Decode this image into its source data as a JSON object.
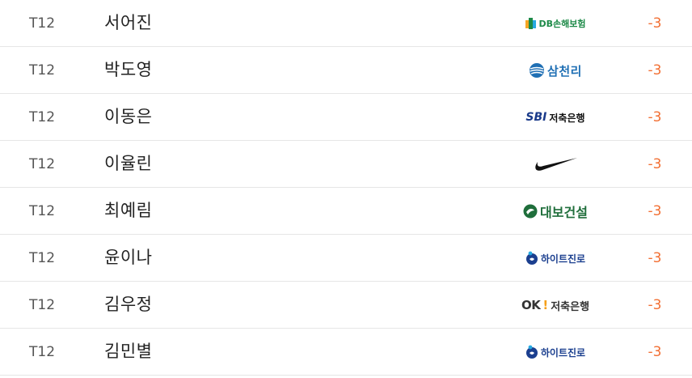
{
  "rows": [
    {
      "rank": "T12",
      "name": "서어진",
      "sponsor": {
        "logo": "db-insurance-logo",
        "text": "DB손해보험"
      },
      "score": "-3"
    },
    {
      "rank": "T12",
      "name": "박도영",
      "sponsor": {
        "logo": "samchully-logo",
        "text": "삼천리"
      },
      "score": "-3"
    },
    {
      "rank": "T12",
      "name": "이동은",
      "sponsor": {
        "logo": "sbi-savings-bank-logo",
        "mark": "SBI",
        "text": "저축은행"
      },
      "score": "-3"
    },
    {
      "rank": "T12",
      "name": "이율린",
      "sponsor": {
        "logo": "nike-swoosh-logo"
      },
      "score": "-3"
    },
    {
      "rank": "T12",
      "name": "최예림",
      "sponsor": {
        "logo": "daebo-construction-logo",
        "text": "대보건설"
      },
      "score": "-3"
    },
    {
      "rank": "T12",
      "name": "윤이나",
      "sponsor": {
        "logo": "hitejinro-logo",
        "text": "하이트진로"
      },
      "score": "-3"
    },
    {
      "rank": "T12",
      "name": "김우정",
      "sponsor": {
        "logo": "ok-savings-bank-logo",
        "mark": "OK",
        "text": "저축은행"
      },
      "score": "-3"
    },
    {
      "rank": "T12",
      "name": "김민별",
      "sponsor": {
        "logo": "hitejinro-logo",
        "text": "하이트진로"
      },
      "score": "-3"
    }
  ],
  "colors": {
    "score": "#f26f33",
    "divider": "#e6e6e6",
    "rank": "#555555",
    "name": "#222222"
  }
}
